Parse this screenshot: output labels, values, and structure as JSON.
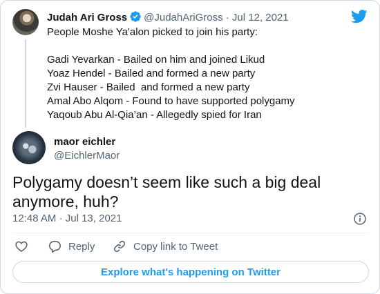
{
  "parent_tweet": {
    "name": "Judah Ari Gross",
    "handle": "@JudahAriGross",
    "dot": "·",
    "date": "Jul 12, 2021",
    "text": "People Moshe Ya'alon picked to join his party:\n\nGadi Yevarkan - Bailed on him and joined Likud\nYoaz Hendel - Bailed and formed a new party\nZvi Hauser - Bailed  and formed a new party\nAmal Abo Alqom - Found to have supported polygamy\nYaqoub Abu Al-Qia’an - Allegedly spied for Iran"
  },
  "tweet": {
    "name": "maor eichler",
    "handle": "@EichlerMaor",
    "text": "Polygamy doesn’t seem like such a big deal anymore, huh?",
    "time": "12:48 AM",
    "dot": "·",
    "date": "Jul 13, 2021"
  },
  "actions": {
    "reply_label": "Reply",
    "copy_label": "Copy link to Tweet"
  },
  "explore_label": "Explore what's happening on Twitter",
  "colors": {
    "accent": "#1d9bf0",
    "text": "#0f1419",
    "secondary": "#536471",
    "border": "#cfd9de"
  },
  "icons": [
    "verified-badge-icon",
    "twitter-bird-icon",
    "info-icon",
    "heart-icon",
    "reply-icon",
    "link-icon"
  ]
}
